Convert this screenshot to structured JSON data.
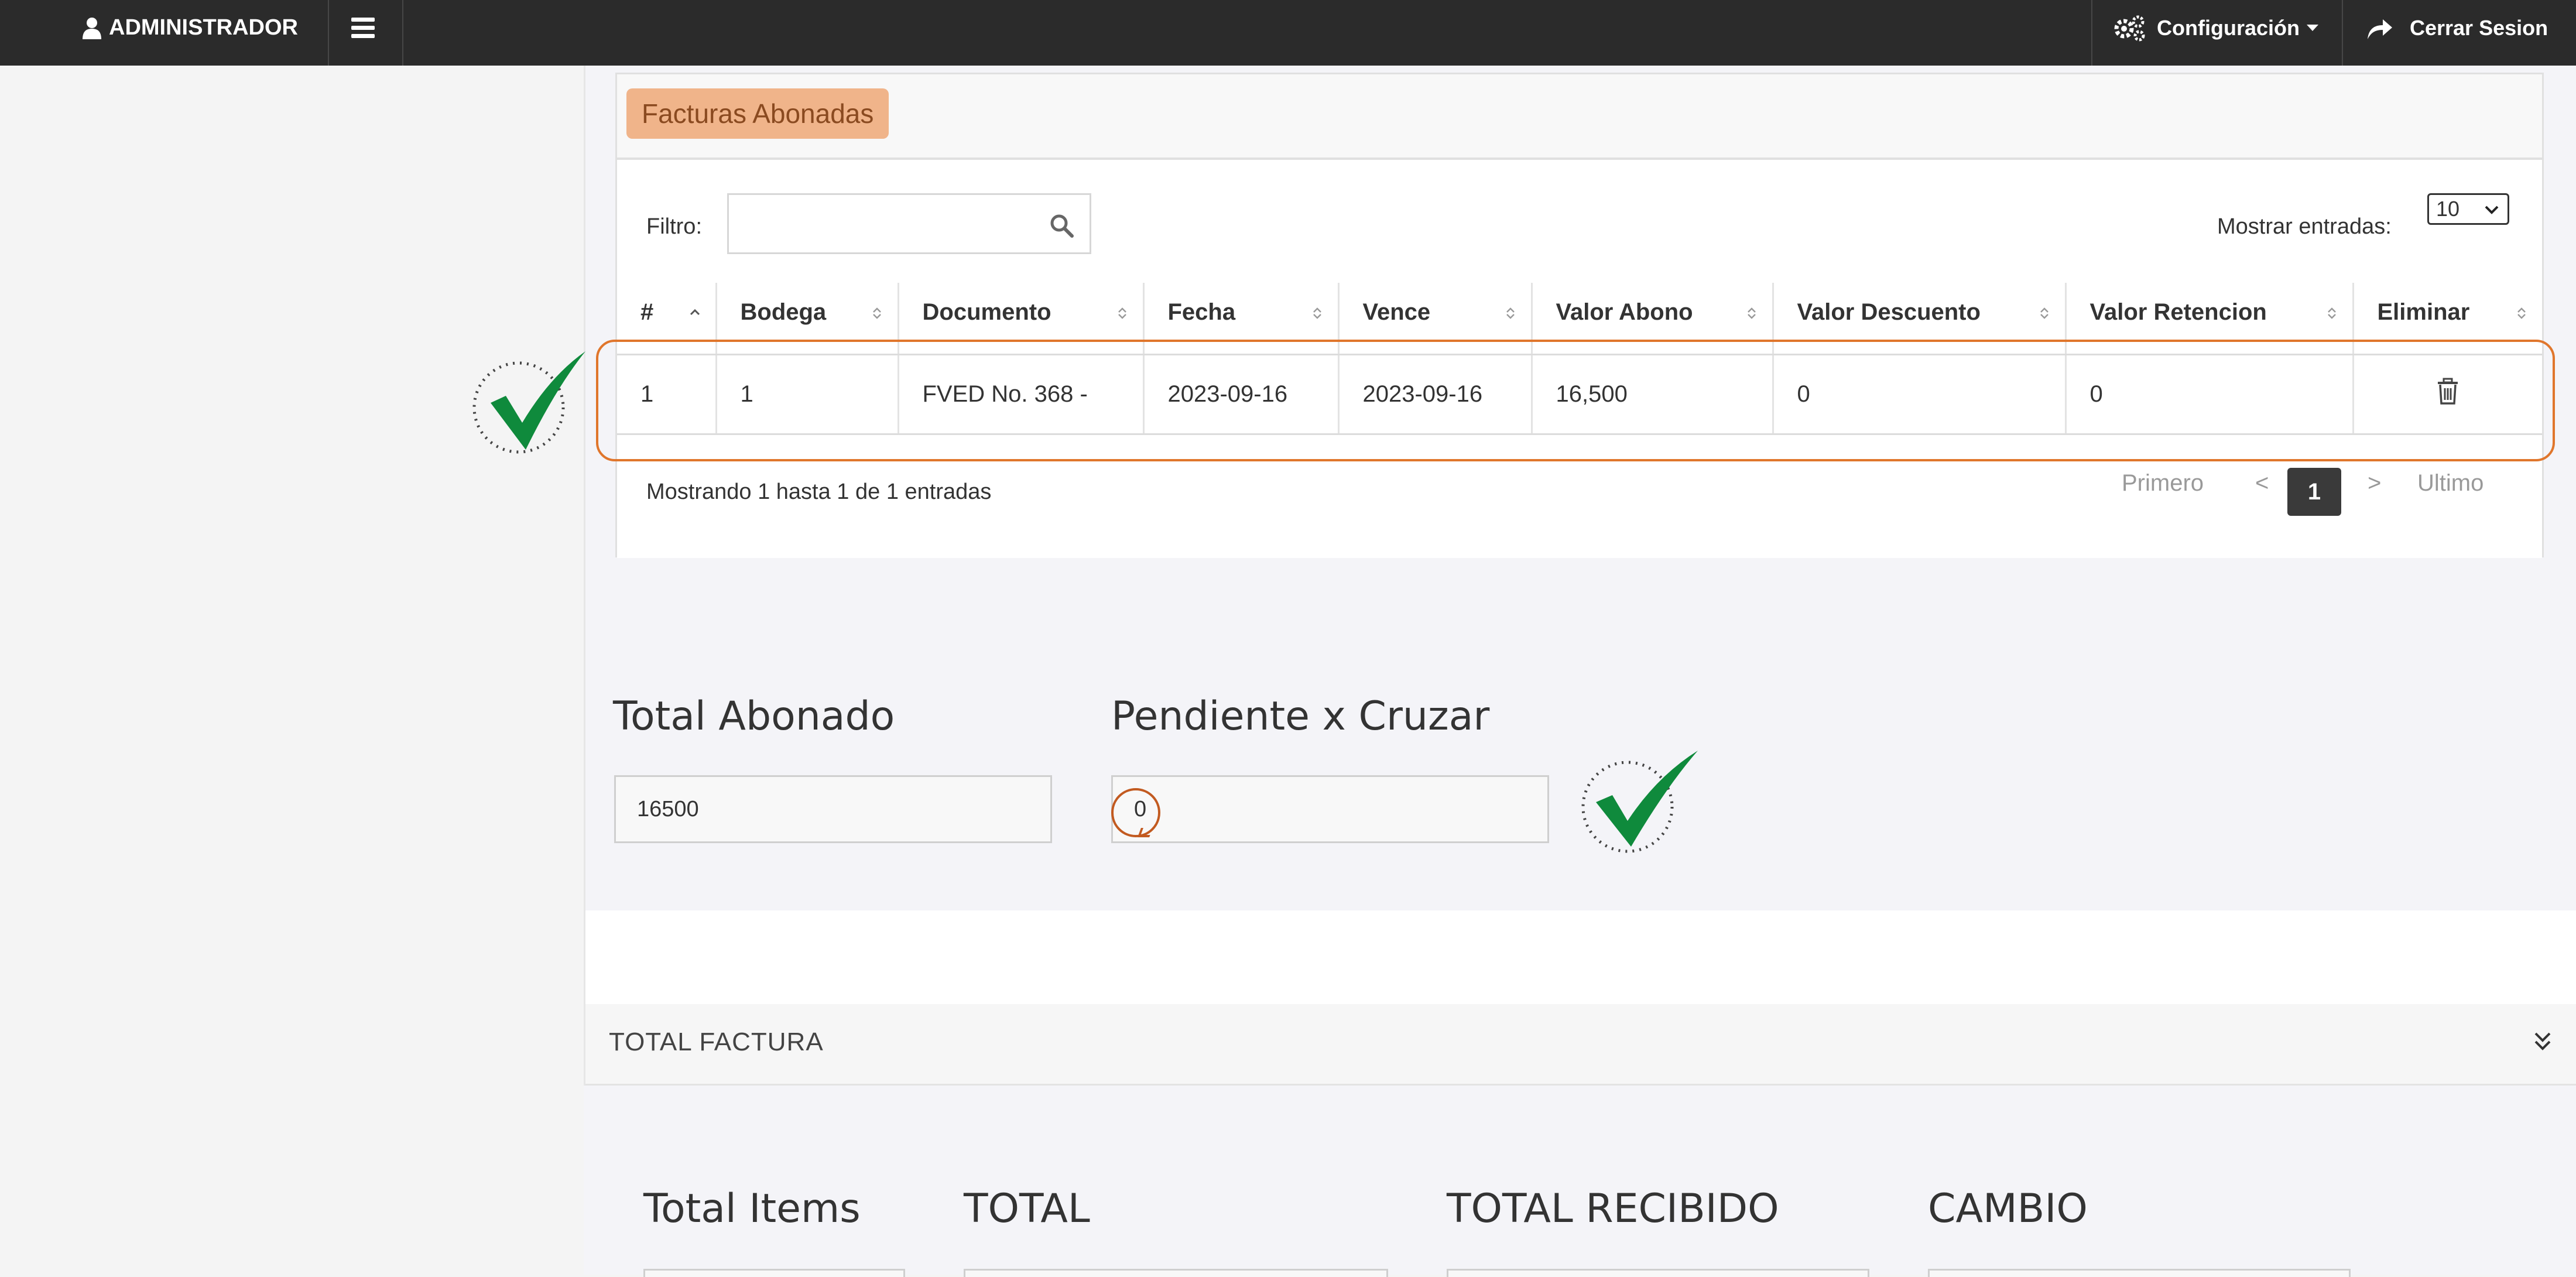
{
  "navbar": {
    "user_label": "ADMINISTRADOR",
    "config_label": "Configuración",
    "logout_label": "Cerrar Sesion"
  },
  "panel": {
    "label": "Facturas Abonadas",
    "filter_label": "Filtro:",
    "filter_value": "",
    "entries_label": "Mostrar entradas:",
    "entries_value": "10",
    "columns": [
      "#",
      "Bodega",
      "Documento",
      "Fecha",
      "Vence",
      "Valor Abono",
      "Valor Descuento",
      "Valor Retencion",
      "Eliminar"
    ],
    "rows": [
      [
        "1",
        "1",
        "FVED No. 368 -",
        "2023-09-16",
        "2023-09-16",
        "16,500",
        "0",
        "0"
      ]
    ],
    "showing_text": "Mostrando 1 hasta 1 de 1 entradas",
    "pager": {
      "first": "Primero",
      "prev": "<",
      "current": "1",
      "next": ">",
      "last": "Ultimo"
    }
  },
  "totals": {
    "abonado_label": "Total Abonado",
    "abonado_value": "16500",
    "pendiente_label": "Pendiente x Cruzar",
    "pendiente_value": "0"
  },
  "total_factura": {
    "header": "TOTAL FACTURA",
    "labels": [
      "Total Items",
      "TOTAL",
      "TOTAL RECIBIDO",
      "CAMBIO"
    ]
  },
  "colors": {
    "navbar": "#2b2b2b",
    "panel_label_bg": "#f0b48a",
    "highlight": "#e0762c",
    "check": "#0f8a3c",
    "pager_active": "#3a3a3a"
  }
}
